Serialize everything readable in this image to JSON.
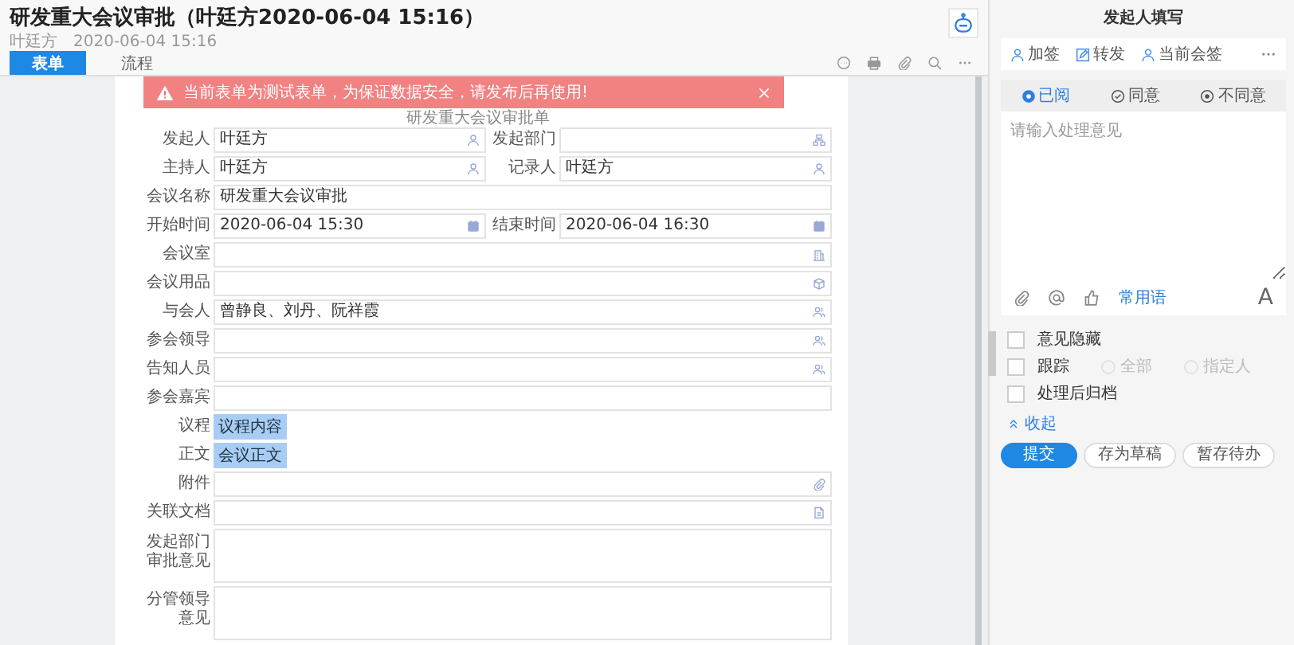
{
  "header": {
    "title": "研发重大会议审批（叶廷方2020-06-04 15:16）",
    "author": "叶廷方",
    "time": "2020-06-04 15:16"
  },
  "tabs": [
    {
      "label": "表单",
      "selected": true
    },
    {
      "label": "流程",
      "selected": false
    }
  ],
  "alert": {
    "text": "当前表单为测试表单，为保证数据安全，请发布后再使用!"
  },
  "form": {
    "title": "研发重大会议审批单",
    "rows": [
      {
        "kind": "pair",
        "fields": [
          {
            "label": "发起人",
            "value": "叶廷方",
            "kind": "user"
          },
          {
            "label": "发起部门",
            "kind": "dept"
          }
        ]
      },
      {
        "kind": "pair",
        "fields": [
          {
            "label": "主持人",
            "value": "叶廷方",
            "kind": "user"
          },
          {
            "label": "记录人",
            "value": "叶廷方",
            "kind": "user"
          }
        ]
      },
      {
        "kind": "full",
        "fields": [
          {
            "label": "会议名称",
            "value": "研发重大会议审批",
            "kind": "text"
          }
        ]
      },
      {
        "kind": "pair",
        "fields": [
          {
            "label": "开始时间",
            "value": "2020-06-04 15:30",
            "kind": "date"
          },
          {
            "label": "结束时间",
            "value": "2020-06-04 16:30",
            "kind": "date"
          }
        ]
      },
      {
        "kind": "full",
        "fields": [
          {
            "label": "会议室",
            "kind": "room"
          }
        ]
      },
      {
        "kind": "full",
        "fields": [
          {
            "label": "会议用品",
            "kind": "goods"
          }
        ]
      },
      {
        "kind": "full",
        "fields": [
          {
            "label": "与会人",
            "value": "曾静良、刘丹、阮祥霞",
            "kind": "users"
          }
        ]
      },
      {
        "kind": "full",
        "fields": [
          {
            "label": "参会领导",
            "kind": "users"
          }
        ]
      },
      {
        "kind": "full",
        "fields": [
          {
            "label": "告知人员",
            "kind": "users"
          }
        ]
      },
      {
        "kind": "full",
        "fields": [
          {
            "label": "参会嘉宾",
            "kind": "text"
          }
        ]
      },
      {
        "kind": "chip",
        "fields": [
          {
            "label": "议程",
            "value": "议程内容"
          }
        ]
      },
      {
        "kind": "chip",
        "fields": [
          {
            "label": "正文",
            "value": "会议正文"
          }
        ]
      },
      {
        "kind": "full",
        "fields": [
          {
            "label": "附件",
            "kind": "file"
          }
        ]
      },
      {
        "kind": "full",
        "fields": [
          {
            "label": "关联文档",
            "kind": "doc"
          }
        ]
      },
      {
        "kind": "area",
        "fields": [
          {
            "label": "发起部门审批意见"
          }
        ]
      },
      {
        "kind": "area",
        "fields": [
          {
            "label": "分管领导意见"
          }
        ]
      }
    ]
  },
  "panel": {
    "title": "发起人填写",
    "actions": [
      {
        "label": "加签",
        "kind": "person"
      },
      {
        "label": "转发",
        "kind": "edit"
      },
      {
        "label": "当前会签",
        "kind": "person"
      }
    ],
    "opinions": [
      {
        "label": "已阅",
        "kind": "radio",
        "selected": true
      },
      {
        "label": "同意",
        "kind": "check",
        "selected": false
      },
      {
        "label": "不同意",
        "kind": "radio",
        "selected": false
      }
    ],
    "placeholder": "请输入处理意见",
    "phrases": "常用语",
    "font_button": "A",
    "options": [
      {
        "label": "意见隐藏",
        "checked": false
      },
      {
        "label": "跟踪",
        "checked": false,
        "choices": [
          {
            "label": "全部",
            "selected": false,
            "disabled": true
          },
          {
            "label": "指定人",
            "selected": false,
            "disabled": true
          }
        ]
      },
      {
        "label": "处理后归档",
        "checked": false
      }
    ],
    "collapse": "收起",
    "buttons": [
      {
        "label": "提交",
        "kind": "primary"
      },
      {
        "label": "存为草稿",
        "kind": "default"
      },
      {
        "label": "暂存待办",
        "kind": "default"
      }
    ]
  }
}
